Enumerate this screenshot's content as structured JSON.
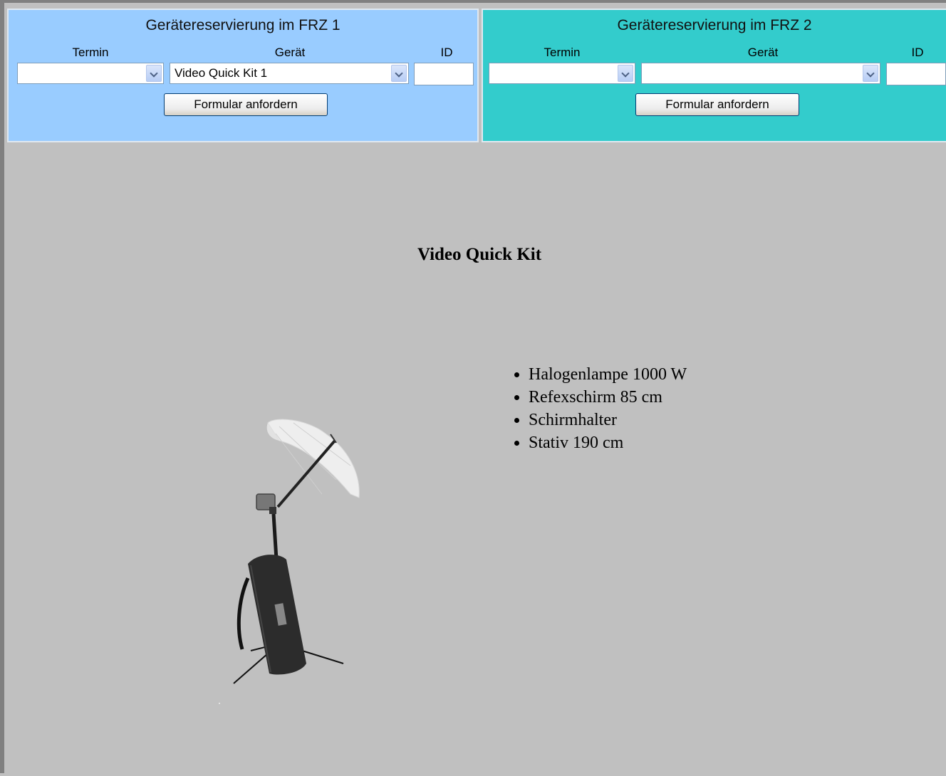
{
  "frz1": {
    "title": "Gerätereservierung im FRZ 1",
    "termin_label": "Termin",
    "geraet_label": "Gerät",
    "id_label": "ID",
    "termin_value": "",
    "geraet_value": "Video Quick Kit 1",
    "id_value": "",
    "button_label": "Formular anfordern",
    "background": "#99ccff"
  },
  "frz2": {
    "title": "Gerätereservierung im FRZ 2",
    "termin_label": "Termin",
    "geraet_label": "Gerät",
    "id_label": "ID",
    "termin_value": "",
    "geraet_value": "",
    "id_value": "",
    "button_label": "Formular anfordern",
    "background": "#33cccc"
  },
  "product": {
    "title": "Video Quick Kit",
    "image_icon": "lighting-kit-umbrella-image",
    "specs": [
      "Halogenlampe 1000 W",
      "Refexschirm 85 cm",
      "Schirmhalter",
      "Stativ 190 cm"
    ]
  }
}
